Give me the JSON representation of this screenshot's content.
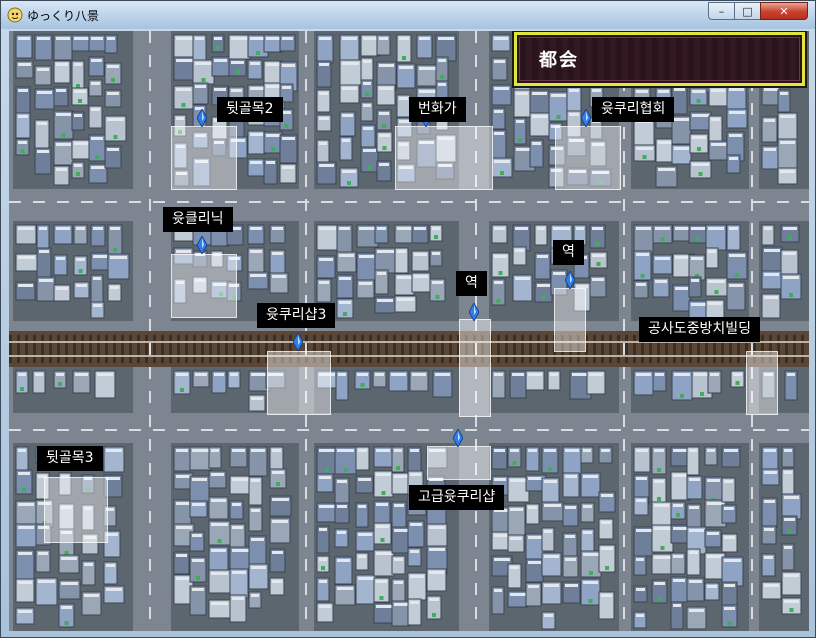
{
  "window": {
    "title": "ゆっくり八景",
    "minimize_icon": "minimize-icon",
    "maximize_icon": "maximize-icon",
    "close_icon": "close-icon",
    "minimize_glyph": "–",
    "maximize_glyph": "□",
    "close_glyph": "✕"
  },
  "map": {
    "area_name": "都会",
    "colors": {
      "area_border": "#e2e63a",
      "label_bg": "#000000",
      "label_text": "#ffffff",
      "marker": "#2f7de8",
      "road": "#7c8590",
      "railway": "#5a4636"
    },
    "locations": [
      {
        "id": "back-alley-2",
        "label": "뒷골목2"
      },
      {
        "id": "downtown",
        "label": "번화가"
      },
      {
        "id": "yukkuri-association",
        "label": "윳쿠리협회"
      },
      {
        "id": "yukkuri-clinic",
        "label": "윳클리닉"
      },
      {
        "id": "station-north",
        "label": "역"
      },
      {
        "id": "station-center",
        "label": "역"
      },
      {
        "id": "yukkuri-shop-3",
        "label": "윳쿠리샵3"
      },
      {
        "id": "construction-building",
        "label": "공사도중방치빌딩"
      },
      {
        "id": "back-alley-3",
        "label": "뒷골목3"
      },
      {
        "id": "premium-yukkuri-shop",
        "label": "고급윳쿠리샵"
      }
    ]
  }
}
